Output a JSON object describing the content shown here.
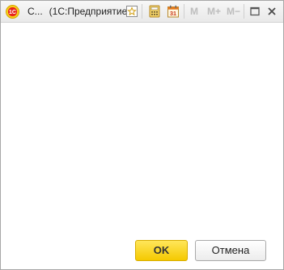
{
  "window": {
    "title": "С...",
    "app_name": "(1С:Предприятие)",
    "logo_text": "1С"
  },
  "toolbar": {
    "icons": [
      "favorites-icon",
      "calculator-icon",
      "calendar-icon"
    ],
    "calendar_day": "31",
    "memory": {
      "m": "M",
      "m_plus": "M+",
      "m_minus": "M−"
    }
  },
  "window_controls": [
    "maximize-icon",
    "close-icon"
  ],
  "buttons": {
    "ok_label": "OK",
    "cancel_label": "Отмена"
  },
  "colors": {
    "ok_button": "#f5c900",
    "logo": "#e8251c"
  }
}
